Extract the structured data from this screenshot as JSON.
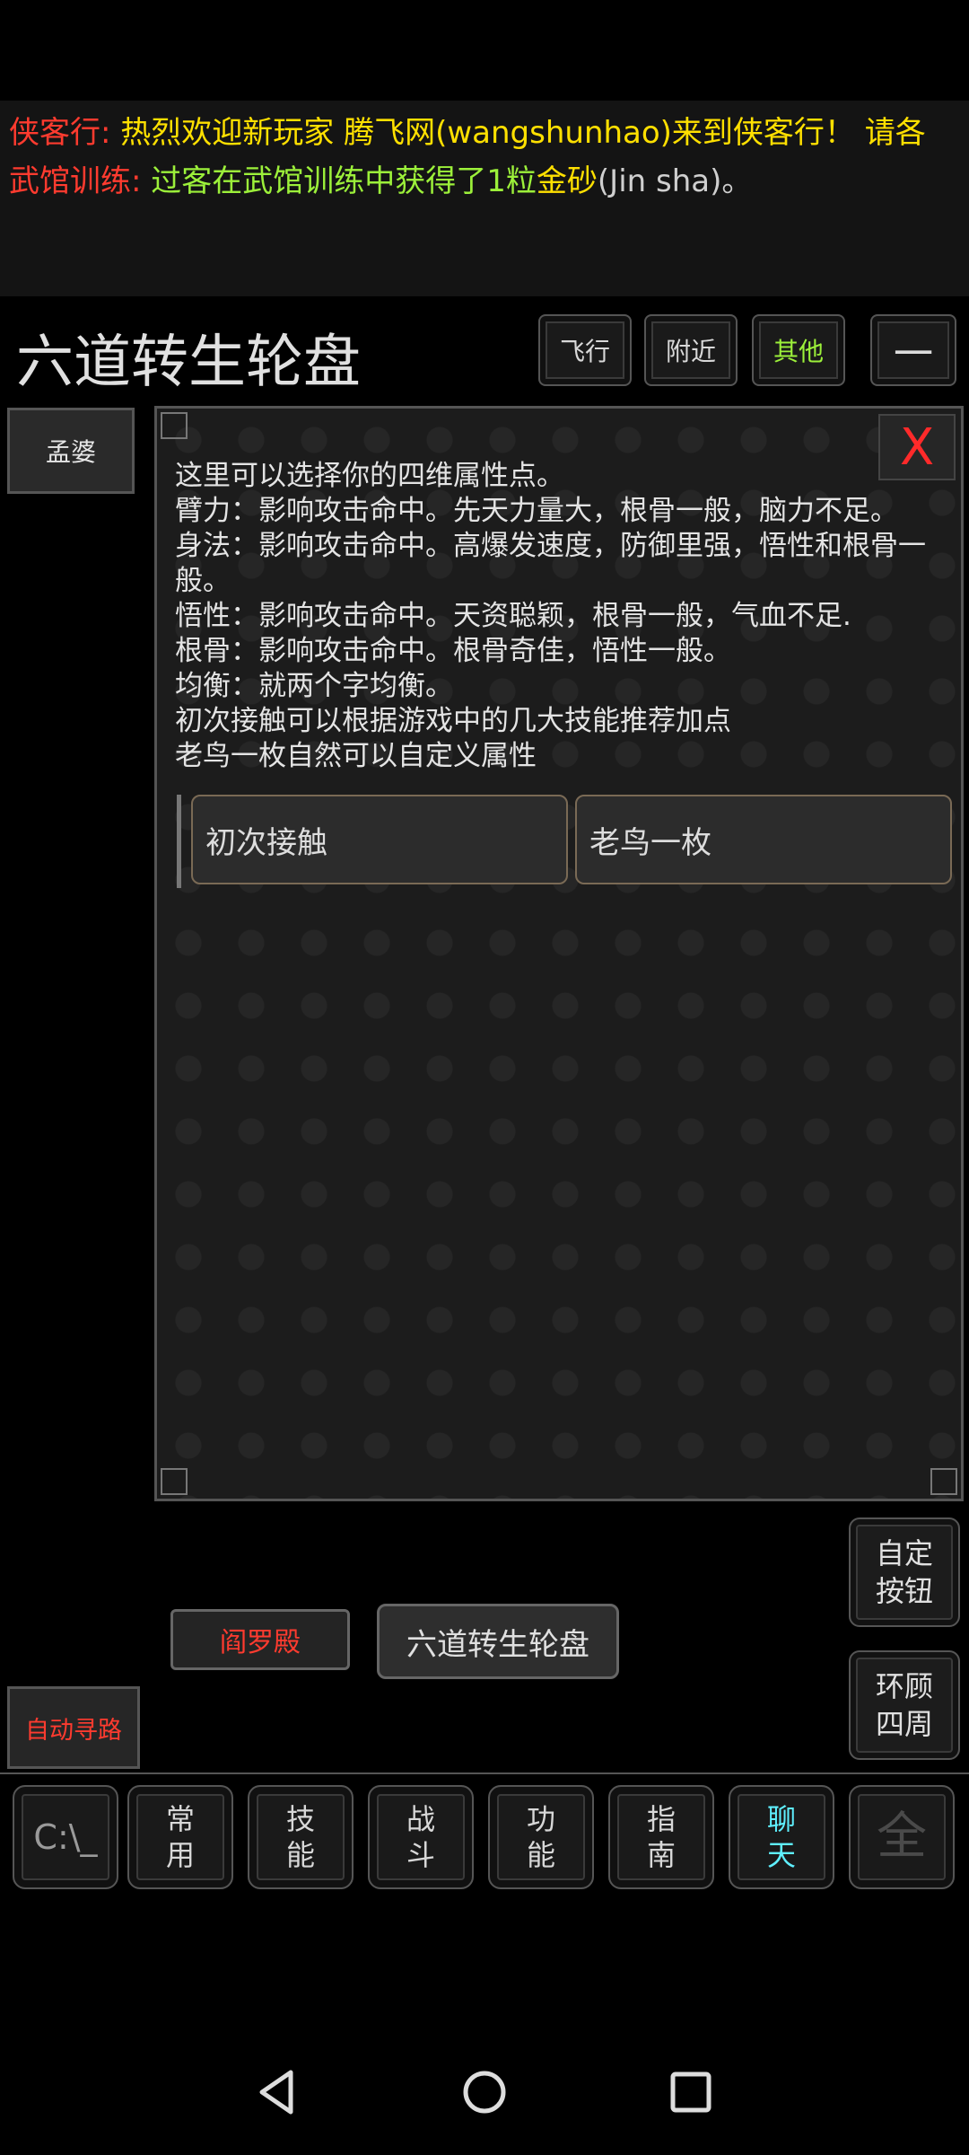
{
  "chat": {
    "line1": {
      "tag": "侠客行:",
      "text": "热烈欢迎新玩家  腾飞网(wangshunhao)来到侠客行！ 请各"
    },
    "line2": {
      "tag": "武馆训练:",
      "text_a": "过客在武馆训练中获得了1粒",
      "item": "金砂",
      "text_b": "(Jin sha)。"
    }
  },
  "room": {
    "title": "六道转生轮盘"
  },
  "top_buttons": [
    {
      "label": "飞行"
    },
    {
      "label": "附近"
    },
    {
      "label": "其他"
    },
    {
      "label": "一"
    }
  ],
  "npc": {
    "label": "孟婆"
  },
  "dialog": {
    "close_label": "X",
    "lines": [
      "这里可以选择你的四维属性点。",
      "臂力：影响攻击命中。先天力量大，根骨一般，脑力不足。",
      "身法：影响攻击命中。高爆发速度，防御里强，悟性和根骨一般。",
      "悟性：影响攻击命中。天资聪颖，根骨一般，气血不足.",
      "根骨：影响攻击命中。根骨奇佳，悟性一般。",
      "均衡：就两个字均衡。",
      "初次接触可以根据游戏中的几大技能推荐加点",
      "老鸟一枚自然可以自定义属性"
    ],
    "choices": [
      {
        "label": "初次接触"
      },
      {
        "label": "老鸟一枚"
      }
    ]
  },
  "side_buttons": [
    {
      "line1": "自定",
      "line2": "按钮"
    },
    {
      "line1": "环顾",
      "line2": "四周"
    }
  ],
  "exits": {
    "red": "阎罗殿",
    "gray": "六道转生轮盘"
  },
  "autopath": {
    "label": "自动寻路"
  },
  "nav": [
    {
      "line1": "C:\\_",
      "line2": ""
    },
    {
      "line1": "常",
      "line2": "用"
    },
    {
      "line1": "技",
      "line2": "能"
    },
    {
      "line1": "战",
      "line2": "斗"
    },
    {
      "line1": "功",
      "line2": "能"
    },
    {
      "line1": "指",
      "line2": "南"
    },
    {
      "line1": "聊",
      "line2": "天"
    },
    {
      "line1": "全",
      "line2": ""
    }
  ],
  "colors": {
    "accent_red": "#ff3b2f",
    "accent_yellow": "#ffe000",
    "accent_green": "#9cf03a",
    "chat_cyan": "#5ff0ff"
  }
}
